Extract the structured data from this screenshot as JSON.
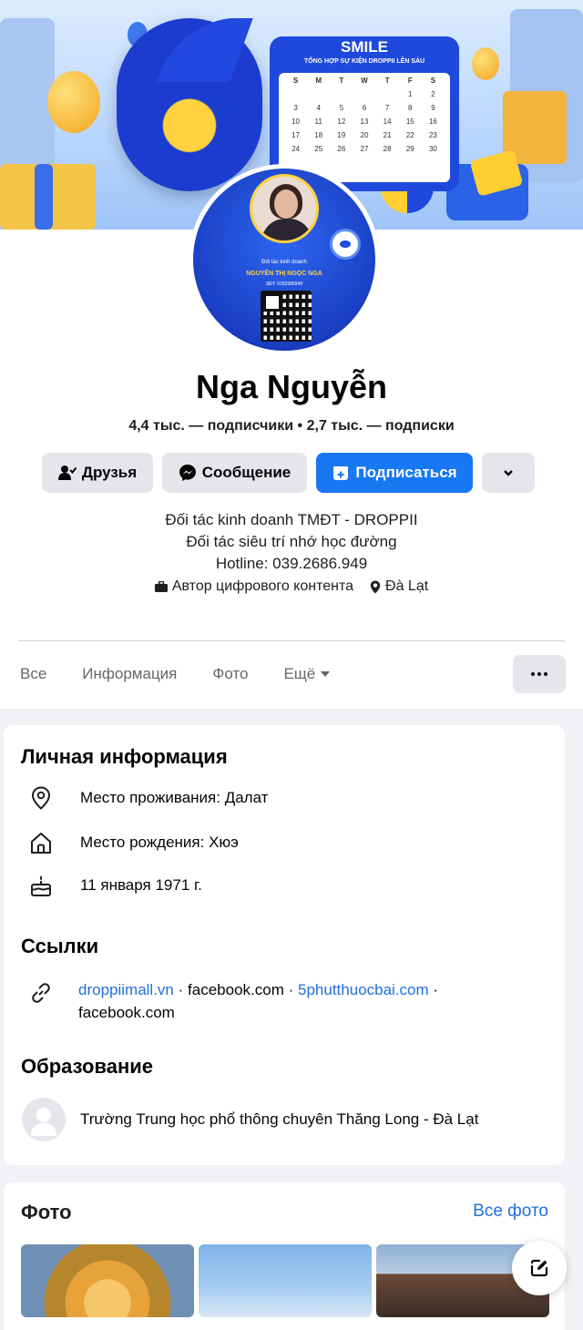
{
  "cover": {
    "calendar_title": "SMILE",
    "calendar_subtitle": "TỔNG HỢP SỰ KIỆN DROPPII LÊN SÁU",
    "calendar_days": [
      "S",
      "M",
      "T",
      "W",
      "T",
      "F",
      "S",
      "",
      "",
      "",
      "",
      "",
      "1",
      "2",
      "3",
      "4",
      "5",
      "6",
      "7",
      "8",
      "9",
      "10",
      "11",
      "12",
      "13",
      "14",
      "15",
      "16",
      "17",
      "18",
      "19",
      "20",
      "21",
      "22",
      "23",
      "24",
      "25",
      "26",
      "27",
      "28",
      "29",
      "30"
    ]
  },
  "avatar": {
    "line1": "Đối tác kinh doanh",
    "line2": "NGUYỄN THỊ NGỌC NGA",
    "line3": "SĐT: 0392686949"
  },
  "profile": {
    "name": "Nga Nguyễn",
    "followers": "4,4 тыс. — подписчики",
    "dot": "•",
    "following": "2,7 тыс. — подписки"
  },
  "actions": {
    "friends": "Друзья",
    "message": "Сообщение",
    "follow": "Подписаться"
  },
  "bio": {
    "line1": "Đối tác kinh doanh TMĐT - DROPPII",
    "line2": "Đối tác siêu trí nhớ học đường",
    "line3": "Hotline: 039.2686.949"
  },
  "meta": {
    "category": "Автор цифрового контента",
    "location": "Đà Lạt"
  },
  "tabs": {
    "all": "Все",
    "info": "Информация",
    "photos": "Фото",
    "more": "Ещё"
  },
  "personal": {
    "title": "Личная информация",
    "residence": "Место проживания: Далат",
    "birthplace": "Место рождения: Хюэ",
    "birthday": "11 января 1971 г."
  },
  "links": {
    "title": "Ссылки",
    "items": [
      "droppiimall.vn",
      "facebook.com",
      "5phutthuocbai.com",
      "facebook.com"
    ],
    "separator": "·"
  },
  "education": {
    "title": "Образование",
    "school": "Trường Trung học phổ thông chuyên Thăng Long - Đà Lạt"
  },
  "photos": {
    "title": "Фото",
    "all": "Все фото"
  },
  "colors": {
    "accent": "#1877f2",
    "link": "#216fdb",
    "button_gray": "#e4e6eb",
    "background": "#f0f2f5"
  }
}
